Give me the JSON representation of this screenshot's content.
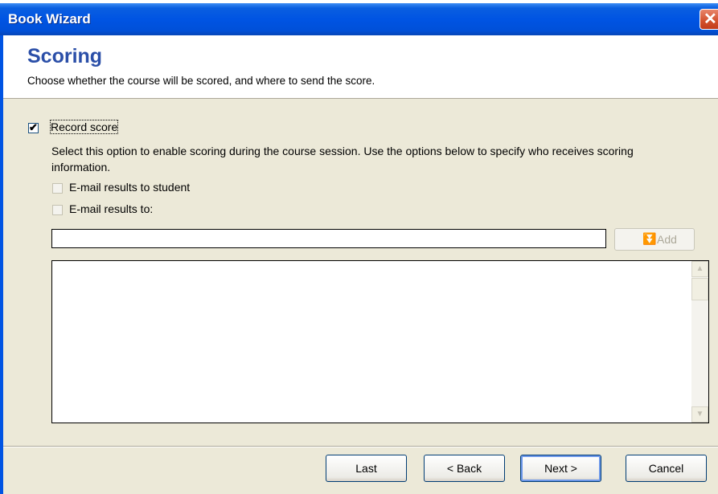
{
  "window": {
    "title": "Book Wizard",
    "close_label": "✕"
  },
  "header": {
    "title": "Scoring",
    "description": "Choose whether the course will be scored, and where to send the score."
  },
  "record_score": {
    "checked": true,
    "check_glyph": "✔",
    "label": "Record score",
    "help": "Select this option to enable scoring during the course session. Use the options below to specify who receives scoring information."
  },
  "email_student": {
    "checked": false,
    "label": "E-mail results to student"
  },
  "email_to": {
    "checked": false,
    "label": "E-mail results to:"
  },
  "email_input": {
    "value": "",
    "placeholder": ""
  },
  "add_button": {
    "label": "Add",
    "icon": "double-down-arrow-icon",
    "glyph": "⏬"
  },
  "recipients": {
    "items": []
  },
  "scroll": {
    "up_glyph": "▲",
    "down_glyph": "▼"
  },
  "footer": {
    "last_label": "Last",
    "back_label": "< Back",
    "next_label": "Next >",
    "cancel_label": "Cancel"
  },
  "colors": {
    "title_bar": "#0054e3",
    "heading": "#2b4fa8",
    "dialog_bg": "#ece9d8"
  }
}
